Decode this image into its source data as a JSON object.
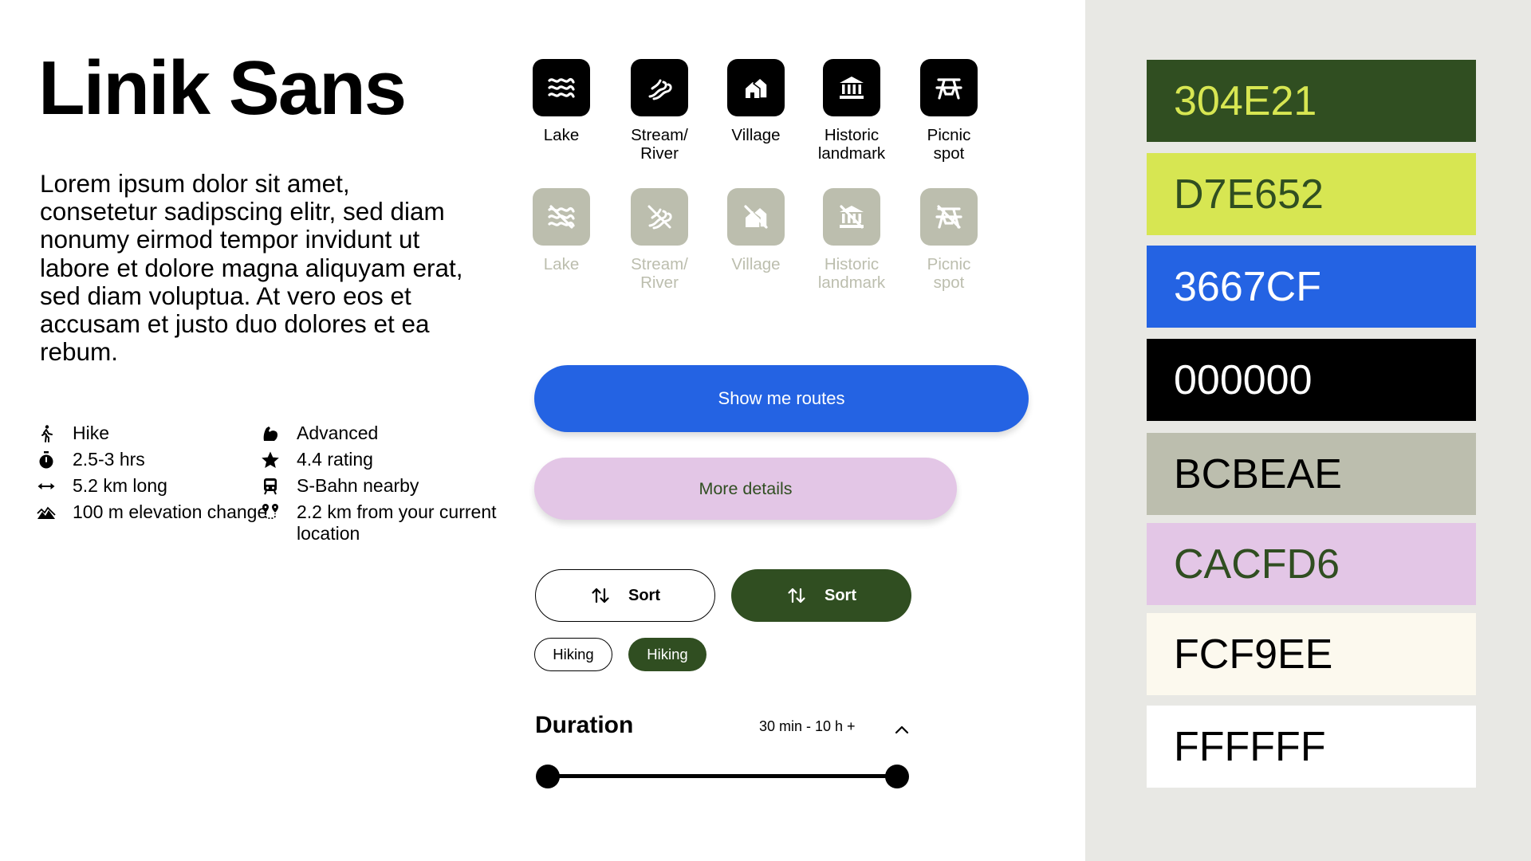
{
  "title": "Linik Sans",
  "lorem": "Lorem ipsum dolor sit amet, consetetur sadipscing elitr, sed diam nonumy eirmod tempor invidunt ut labore et dolore magna aliquyam erat, sed diam voluptua. At vero eos et accusam et justo duo dolores et ea rebum.",
  "meta_left": [
    {
      "icon": "hiker-icon",
      "text": "Hike"
    },
    {
      "icon": "stopwatch-icon",
      "text": "2.5-3 hrs"
    },
    {
      "icon": "horizontal-arrows-icon",
      "text": "5.2 km long"
    },
    {
      "icon": "elevation-icon",
      "text": "100 m elevation change"
    }
  ],
  "meta_right": [
    {
      "icon": "flexed-arm-icon",
      "text": "Advanced"
    },
    {
      "icon": "star-icon",
      "text": "4.4 rating"
    },
    {
      "icon": "train-icon",
      "text": "S-Bahn nearby"
    },
    {
      "icon": "route-pins-icon",
      "text": "2.2 km from your current location"
    }
  ],
  "poi_icons": {
    "active": [
      {
        "icon": "lake-icon",
        "label": "Lake"
      },
      {
        "icon": "stream-river-icon",
        "label": "Stream/\nRiver"
      },
      {
        "icon": "village-icon",
        "label": "Village"
      },
      {
        "icon": "historic-landmark-icon",
        "label": "Historic\nlandmark"
      },
      {
        "icon": "picnic-spot-icon",
        "label": "Picnic\nspot"
      }
    ],
    "disabled": [
      {
        "icon": "lake-off-icon",
        "label": "Lake"
      },
      {
        "icon": "stream-river-off-icon",
        "label": "Stream/\nRiver"
      },
      {
        "icon": "village-off-icon",
        "label": "Village"
      },
      {
        "icon": "historic-landmark-off-icon",
        "label": "Historic\nlandmark"
      },
      {
        "icon": "picnic-spot-off-icon",
        "label": "Picnic\nspot"
      }
    ]
  },
  "buttons": {
    "primary": "Show me routes",
    "secondary": "More details",
    "sort_outline": "Sort",
    "sort_filled": "Sort",
    "chip_outline": "Hiking",
    "chip_filled": "Hiking"
  },
  "duration": {
    "title": "Duration",
    "range": "30 min - 10 h +",
    "slider_min_fraction": 0,
    "slider_max_fraction": 1
  },
  "palette": [
    {
      "hex": "304E21",
      "bg": "#304E21",
      "fg": "#D7E652"
    },
    {
      "hex": "D7E652",
      "bg": "#D7E652",
      "fg": "#304E21"
    },
    {
      "hex": "3667CF",
      "bg": "#2463E3",
      "fg": "#FFFFFF"
    },
    {
      "hex": "000000",
      "bg": "#000000",
      "fg": "#FFFFFF"
    },
    {
      "hex": "BCBEAE",
      "bg": "#BCBEAE",
      "fg": "#000000"
    },
    {
      "hex": "CACFD6",
      "bg": "#E3C6E6",
      "fg": "#304E21"
    },
    {
      "hex": "FCF9EE",
      "bg": "#FCF9EE",
      "fg": "#000000"
    },
    {
      "hex": "FFFFFF",
      "bg": "#FFFFFF",
      "fg": "#000000"
    }
  ],
  "colors": {
    "accent_blue": "#2463E3",
    "forest_green": "#304E21",
    "lilac": "#E3C6E6",
    "muted_gray": "#BCBEAE",
    "panel_bg": "#E8E8E4"
  }
}
